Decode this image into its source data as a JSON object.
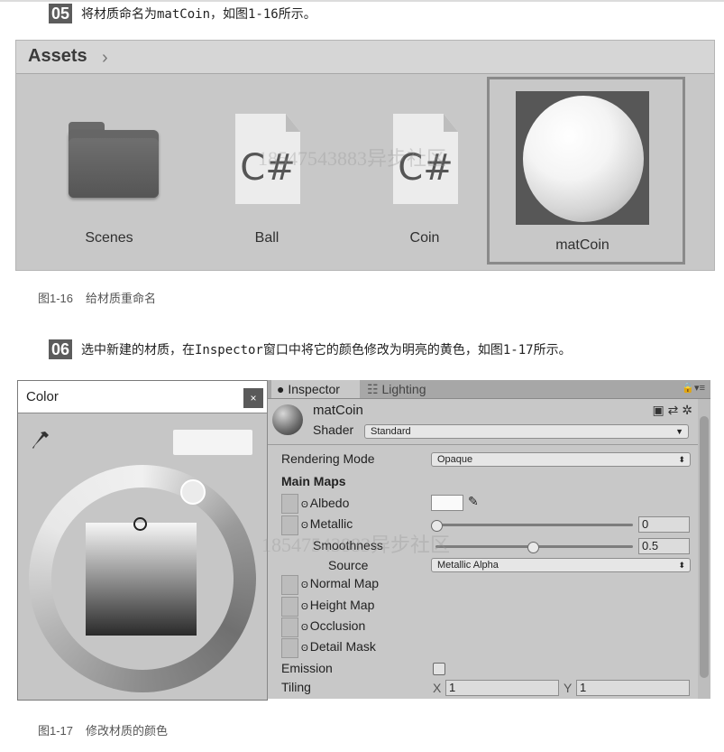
{
  "step05": {
    "num": "05",
    "text": "将材质命名为matCoin，如图1-16所示。"
  },
  "assets_panel": {
    "title": "Assets",
    "chevron": "›",
    "items": [
      {
        "label": "Scenes",
        "icon": "folder-icon"
      },
      {
        "label": "Ball",
        "icon": "csharp-script-icon",
        "glyph": "C#"
      },
      {
        "label": "Coin",
        "icon": "csharp-script-icon",
        "glyph": "C#"
      },
      {
        "label": "matCoin",
        "icon": "material-sphere-icon"
      }
    ]
  },
  "watermark": "18547543883异步社区",
  "fig16": {
    "num": "图1-16",
    "text": "给材质重命名"
  },
  "step06": {
    "num": "06",
    "text": "选中新建的材质，在Inspector窗口中将它的颜色修改为明亮的黄色，如图1-17所示。"
  },
  "color_window": {
    "title": "Color",
    "close": "×"
  },
  "inspector": {
    "tabs": [
      {
        "label": "Inspector",
        "icon": "info-icon"
      },
      {
        "label": "Lighting",
        "icon": "lighting-icon"
      }
    ],
    "lock": "🔒▾≡",
    "material_name": "matCoin",
    "shader_label": "Shader",
    "shader_value": "Standard",
    "rendering_mode_label": "Rendering Mode",
    "rendering_mode_value": "Opaque",
    "main_maps_label": "Main Maps",
    "albedo_label": "Albedo",
    "metallic_label": "Metallic",
    "metallic_value": "0",
    "smoothness_label": "Smoothness",
    "smoothness_value": "0.5",
    "source_label": "Source",
    "source_value": "Metallic Alpha",
    "normal_map_label": "Normal Map",
    "height_map_label": "Height Map",
    "occlusion_label": "Occlusion",
    "detail_mask_label": "Detail Mask",
    "emission_label": "Emission",
    "tiling_label": "Tiling",
    "tiling_x_label": "X",
    "tiling_x_value": "1",
    "tiling_y_label": "Y",
    "tiling_y_value": "1",
    "slider_levels": {
      "metallic": 0.0,
      "smoothness": 0.5
    }
  },
  "fig17": {
    "num": "图1-17",
    "text": "修改材质的颜色"
  }
}
